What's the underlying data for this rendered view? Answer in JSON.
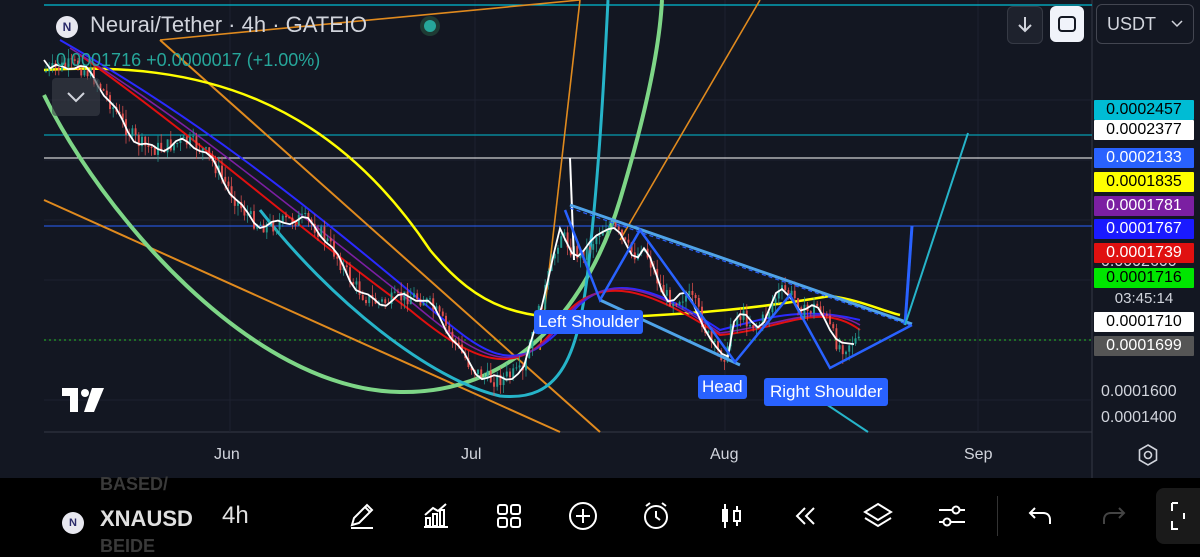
{
  "header": {
    "symbol_title": "Neurai/Tether · 4h · GATEIO",
    "change_line": "0.0001716 +0.0000017 (+1.00%)",
    "logo_letter": "N"
  },
  "top_right": {
    "currency": "USDT"
  },
  "price_axis": {
    "tick_labels": [
      {
        "label": "0.0002600",
        "price": 0.00026
      },
      {
        "label": "0.0001600",
        "price": 0.00016
      },
      {
        "label": "0.0001400",
        "price": 0.00014
      }
    ],
    "price_tags": [
      {
        "label": "0.0002457",
        "price": 0.0002457,
        "bg": "#00bcd4",
        "fg": "#000000"
      },
      {
        "label": "0.0002377",
        "price": 0.0002377,
        "bg": "#ffffff",
        "fg": "#000000"
      },
      {
        "label": "0.0002133",
        "price": 0.0002133,
        "bg": "#2962ff",
        "fg": "#ffffff"
      },
      {
        "label": "0.0001835",
        "price": 0.0001835,
        "bg": "#ffff00",
        "fg": "#000000"
      },
      {
        "label": "0.0001781",
        "price": 0.0001781,
        "bg": "#7b1fa2",
        "fg": "#ffffff"
      },
      {
        "label": "0.0001767",
        "price": 0.0001767,
        "bg": "#1a1aff",
        "fg": "#ffffff"
      },
      {
        "label": "0.0001739",
        "price": 0.0001739,
        "bg": "#e01010",
        "fg": "#ffffff"
      },
      {
        "label": "0.0001716",
        "price": 0.0001716,
        "bg": "#00e600",
        "fg": "#000000"
      },
      {
        "label": "0.0001710",
        "price": 0.000171,
        "bg": "#ffffff",
        "fg": "#000000"
      },
      {
        "label": "0.0001699",
        "price": 0.0001699,
        "bg": "#555555",
        "fg": "#ffffff"
      }
    ],
    "countdown": "03:45:14"
  },
  "time_axis": {
    "months": [
      "Jun",
      "Jul",
      "Aug",
      "Sep"
    ]
  },
  "annotations": {
    "left_shoulder": "Left Shoulder",
    "head": "Head",
    "right_shoulder": "Right Shoulder"
  },
  "toolbar": {
    "symbol": "XNAUSD",
    "ghost_above": "BASED/",
    "ghost_below": "BEIDE",
    "interval": "4h",
    "icons": [
      "pen-icon",
      "indicators-icon",
      "layouts-icon",
      "add-icon",
      "alert-icon",
      "candle-type-icon",
      "replay-icon",
      "layers-icon",
      "settings-sliders-icon",
      "undo-icon",
      "redo-icon"
    ]
  },
  "colors": {
    "background": "#131722",
    "bull": "#26a69a",
    "bear": "#ef5350"
  }
}
